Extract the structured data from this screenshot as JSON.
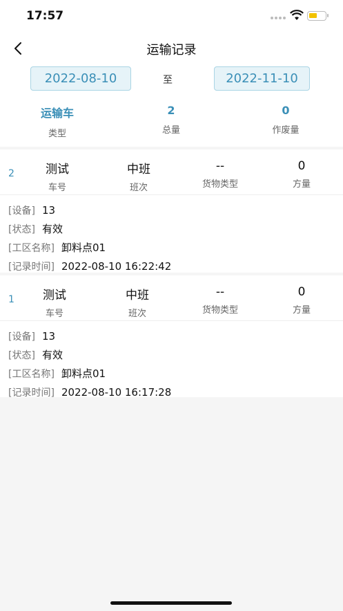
{
  "status": {
    "time": "17:57"
  },
  "nav": {
    "title": "运输记录"
  },
  "filter": {
    "start_date": "2022-08-10",
    "separator": "至",
    "end_date": "2022-11-10"
  },
  "summary": [
    {
      "value": "运输车",
      "label": "类型"
    },
    {
      "value": "2",
      "label": "总量"
    },
    {
      "value": "0",
      "label": "作废量"
    }
  ],
  "records": [
    {
      "index": "2",
      "head": [
        {
          "value": "测试",
          "label": "车号"
        },
        {
          "value": "中班",
          "label": "班次"
        },
        {
          "value": "--",
          "label": "货物类型"
        },
        {
          "value": "0",
          "label": "方量"
        }
      ],
      "details": [
        {
          "label": "[设备]",
          "value": "13"
        },
        {
          "label": "[状态]",
          "value": "有效"
        },
        {
          "label": "[工区名称]",
          "value": "卸料点01"
        },
        {
          "label": "[记录时间]",
          "value": "2022-08-10 16:22:42"
        }
      ]
    },
    {
      "index": "1",
      "head": [
        {
          "value": "测试",
          "label": "车号"
        },
        {
          "value": "中班",
          "label": "班次"
        },
        {
          "value": "--",
          "label": "货物类型"
        },
        {
          "value": "0",
          "label": "方量"
        }
      ],
      "details": [
        {
          "label": "[设备]",
          "value": "13"
        },
        {
          "label": "[状态]",
          "value": "有效"
        },
        {
          "label": "[工区名称]",
          "value": "卸料点01"
        },
        {
          "label": "[记录时间]",
          "value": "2022-08-10 16:17:28"
        }
      ]
    }
  ]
}
